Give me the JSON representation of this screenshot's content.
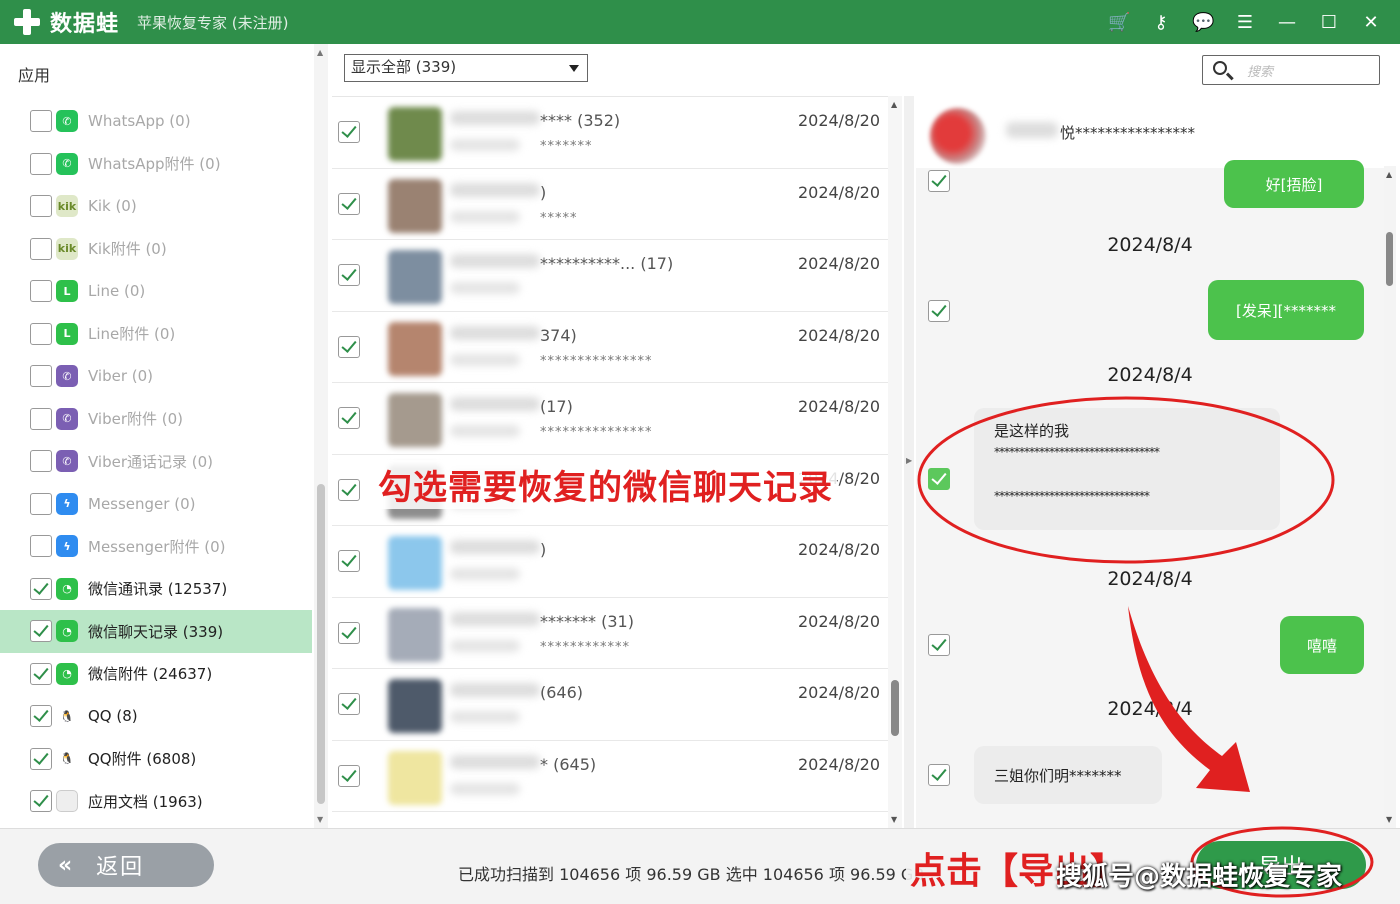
{
  "titlebar": {
    "logo": "数据蛙",
    "subtitle": "苹果恢复专家 (未注册)",
    "icons": [
      "cart-icon",
      "key-icon",
      "chat-icon",
      "list-icon",
      "minimize-icon",
      "maximize-icon",
      "close-icon"
    ]
  },
  "sidebar": {
    "heading": "应用",
    "items": [
      {
        "label": "WhatsApp (0)",
        "checked": false,
        "dim": true,
        "icon": "whatsapp-icon",
        "color": "#25c25a",
        "glyph": "✆"
      },
      {
        "label": "WhatsApp附件 (0)",
        "checked": false,
        "dim": true,
        "icon": "whatsapp-icon",
        "color": "#25c25a",
        "glyph": "✆"
      },
      {
        "label": "Kik (0)",
        "checked": false,
        "dim": true,
        "icon": "kik-icon",
        "color": "#dfe8c8",
        "glyph": "kik"
      },
      {
        "label": "Kik附件 (0)",
        "checked": false,
        "dim": true,
        "icon": "kik-icon",
        "color": "#dfe8c8",
        "glyph": "kik"
      },
      {
        "label": "Line (0)",
        "checked": false,
        "dim": true,
        "icon": "line-icon",
        "color": "#2ec04a",
        "glyph": "L"
      },
      {
        "label": "Line附件 (0)",
        "checked": false,
        "dim": true,
        "icon": "line-icon",
        "color": "#2ec04a",
        "glyph": "L"
      },
      {
        "label": "Viber (0)",
        "checked": false,
        "dim": true,
        "icon": "viber-icon",
        "color": "#7b5fb3",
        "glyph": "✆"
      },
      {
        "label": "Viber附件 (0)",
        "checked": false,
        "dim": true,
        "icon": "viber-icon",
        "color": "#7b5fb3",
        "glyph": "✆"
      },
      {
        "label": "Viber通话记录 (0)",
        "checked": false,
        "dim": true,
        "icon": "viber-icon",
        "color": "#7b5fb3",
        "glyph": "✆"
      },
      {
        "label": "Messenger (0)",
        "checked": false,
        "dim": true,
        "icon": "messenger-icon",
        "color": "#2f8cf0",
        "glyph": "ϟ"
      },
      {
        "label": "Messenger附件 (0)",
        "checked": false,
        "dim": true,
        "icon": "messenger-icon",
        "color": "#2f8cf0",
        "glyph": "ϟ"
      },
      {
        "label": "微信通讯录 (12537)",
        "checked": true,
        "dim": false,
        "icon": "wechat-icon",
        "color": "#2ec04a",
        "glyph": "◔"
      },
      {
        "label": "微信聊天记录 (339)",
        "checked": true,
        "dim": false,
        "active": true,
        "icon": "wechat-icon",
        "color": "#2ec04a",
        "glyph": "◔"
      },
      {
        "label": "微信附件 (24637)",
        "checked": true,
        "dim": false,
        "icon": "wechat-icon",
        "color": "#2ec04a",
        "glyph": "◔"
      },
      {
        "label": "QQ (8)",
        "checked": true,
        "dim": false,
        "icon": "qq-icon",
        "color": "#ffffff",
        "glyph": "🐧"
      },
      {
        "label": "QQ附件 (6808)",
        "checked": true,
        "dim": false,
        "icon": "qq-icon",
        "color": "#ffffff",
        "glyph": "🐧"
      },
      {
        "label": "应用文档 (1963)",
        "checked": true,
        "dim": false,
        "icon": "document-icon",
        "color": "#eeeeee",
        "glyph": ""
      }
    ]
  },
  "filter": {
    "label": "显示全部 (339)"
  },
  "search": {
    "placeholder": "搜索"
  },
  "conversations": [
    {
      "title": "**** (352)",
      "sub": "*******",
      "date": "2024/8/20",
      "avatar": "#6f8a4c"
    },
    {
      "title": ")",
      "sub": "*****",
      "date": "2024/8/20",
      "avatar": "#9a8272"
    },
    {
      "title": "**********... (17)",
      "sub": "",
      "date": "2024/8/20",
      "avatar": "#7d8ea0"
    },
    {
      "title": "374)",
      "sub": "***************",
      "date": "2024/8/20",
      "avatar": "#b5856e"
    },
    {
      "title": "(17)",
      "sub": "***************",
      "date": "2024/8/20",
      "avatar": "#a59a8e"
    },
    {
      "title": "",
      "sub": "",
      "date": "2024/8/20",
      "avatar": "#8d8d8d"
    },
    {
      "title": ")",
      "sub": "",
      "date": "2024/8/20",
      "avatar": "#8cc7ec"
    },
    {
      "title": "******* (31)",
      "sub": "************",
      "date": "2024/8/20",
      "avatar": "#a5acb8"
    },
    {
      "title": "(646)",
      "sub": "",
      "date": "2024/8/20",
      "avatar": "#4e5a6a"
    },
    {
      "title": "* (645)",
      "sub": "",
      "date": "2024/8/20",
      "avatar": "#efe6a0"
    }
  ],
  "chat": {
    "contact": "悦****************",
    "bubbles": {
      "out1": "好[捂脸]",
      "out2": "[发呆][*******",
      "in1_line1": "是这样的我",
      "in1_line2": "*********************************",
      "in1_line3": "*******************************",
      "out3": "嘻嘻",
      "in2": "三姐你们明*******"
    },
    "dates": [
      "2024/8/4",
      "2024/8/4",
      "2024/8/4",
      "2024/8/4"
    ]
  },
  "bottom": {
    "back_label": "返回",
    "status": "已成功扫描到 104656 项 96.59 GB  选中 104656 项 96.59 GB",
    "export_label": "导出"
  },
  "annotations": {
    "main": "勾选需要恢复的微信聊天记录",
    "click": "点击【导出】",
    "watermark": "搜狐号@数据蛙恢复专家"
  },
  "colors": {
    "brand": "#2f8f4a",
    "active_row": "#b9e6c6",
    "bubble_out": "#4cc24c",
    "annotation": "#e02020"
  }
}
